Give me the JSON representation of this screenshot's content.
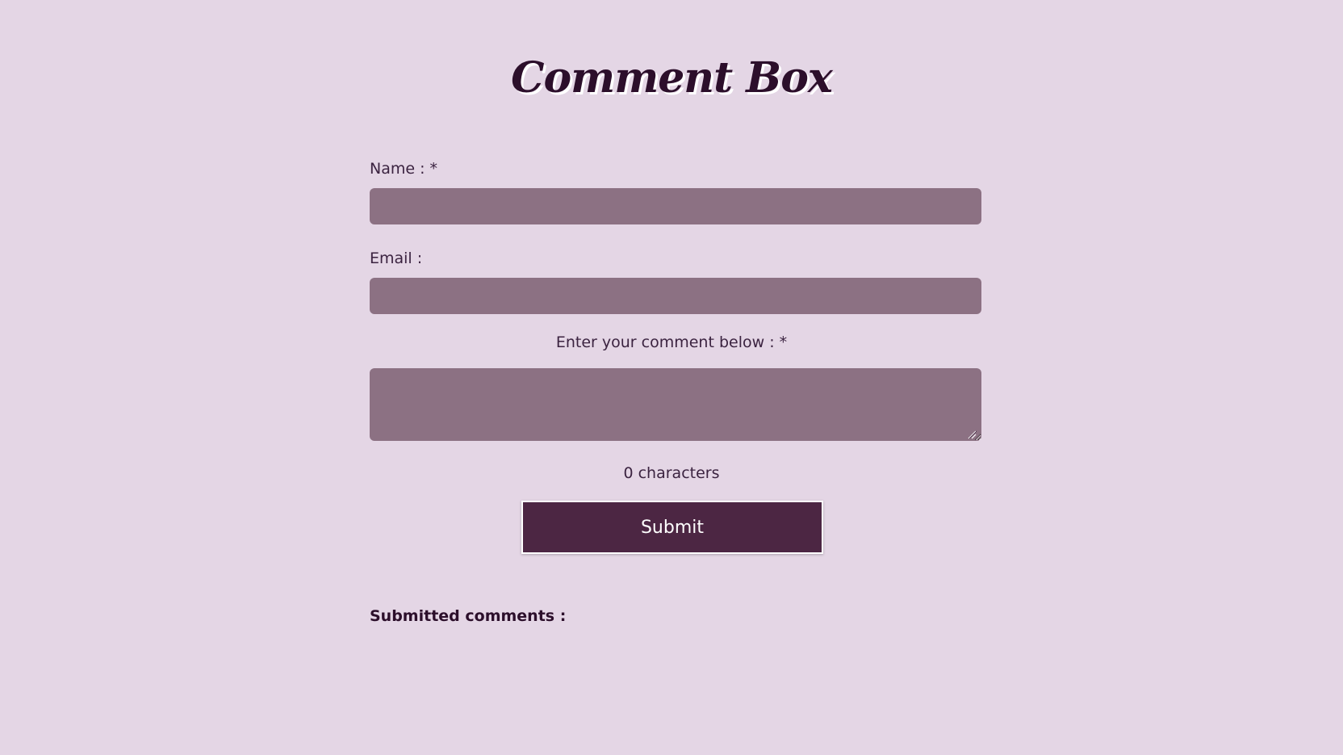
{
  "page": {
    "title": "Comment Box"
  },
  "form": {
    "name_label": "Name : *",
    "name_value": "",
    "email_label": "Email :",
    "email_value": "",
    "comment_label": "Enter your comment below : *",
    "comment_value": "",
    "char_count": "0 characters",
    "submit_label": "Submit"
  },
  "comments": {
    "heading": "Submitted comments :",
    "items": []
  },
  "colors": {
    "background": "#e4d6e5",
    "input_fill": "#8c7183",
    "button_fill": "#4c2643",
    "title_text": "#2c0f2b"
  }
}
